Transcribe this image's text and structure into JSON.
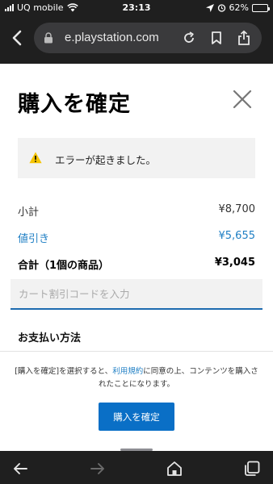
{
  "status_bar": {
    "carrier": "UQ mobile",
    "time": "23:13",
    "battery_text": "62%",
    "battery_level": 0.62,
    "icons": [
      "signal-icon",
      "wifi-icon",
      "location-arrow-icon",
      "alarm-icon",
      "battery-icon"
    ]
  },
  "browser": {
    "url": "e.playstation.com",
    "icons": [
      "back-chevron-icon",
      "lock-icon",
      "reload-icon",
      "bookmark-icon",
      "share-icon"
    ]
  },
  "page": {
    "title": "購入を確定",
    "close_icon": "close-icon",
    "error": {
      "icon": "warning-icon",
      "message": "エラーが起きました。"
    },
    "summary": {
      "subtotal_label": "小計",
      "subtotal_value": "¥8,700",
      "discount_label": "値引き",
      "discount_value": "¥5,655",
      "total_label": "合計（1個の商品）",
      "total_value": "¥3,045"
    },
    "coupon": {
      "placeholder": "カート割引コードを入力",
      "value": ""
    },
    "payment_heading": "お支払い方法",
    "terms": {
      "prefix": "[購入を確定]を選択すると、",
      "link": "利用規約",
      "suffix": "に同意の上、コンテンツを購入されたことになります。"
    },
    "confirm_button": "購入を確定"
  },
  "bottom_bar": {
    "icons": [
      "back-arrow-icon",
      "forward-arrow-icon",
      "home-icon",
      "tabs-icon"
    ]
  },
  "colors": {
    "accent": "#0a6fc6",
    "link": "#1f7fc4",
    "warning": "#f5c400",
    "browser_chrome": "#1f1f1f"
  }
}
